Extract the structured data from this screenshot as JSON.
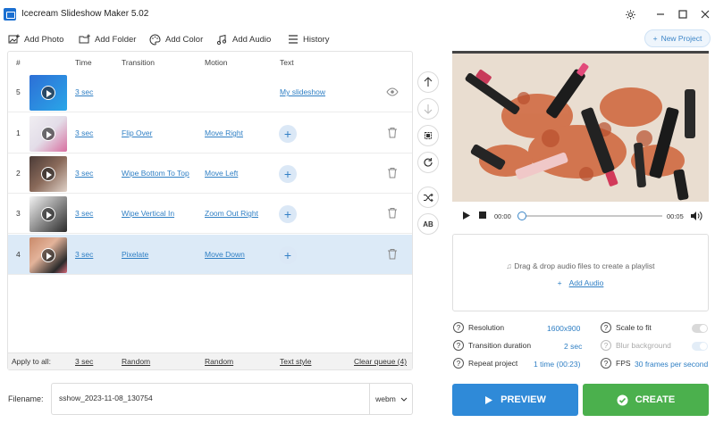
{
  "window": {
    "title": "Icecream Slideshow Maker 5.02"
  },
  "toolbar": {
    "add_photo": "Add Photo",
    "add_folder": "Add Folder",
    "add_color": "Add Color",
    "add_audio": "Add Audio",
    "history": "History",
    "new_project": "New Project"
  },
  "table": {
    "headers": {
      "num": "#",
      "time": "Time",
      "transition": "Transition",
      "motion": "Motion",
      "text": "Text"
    },
    "rows": [
      {
        "num": "5",
        "time": "3 sec",
        "transition": "",
        "motion": "",
        "text": "My slideshow",
        "thumb": "title-slide"
      },
      {
        "num": "1",
        "time": "3 sec",
        "transition": "Flip Over",
        "motion": "Move Right",
        "text": "",
        "thumb": "compact-pink"
      },
      {
        "num": "2",
        "time": "3 sec",
        "transition": "Wipe Bottom To Top",
        "motion": "Move Left",
        "text": "",
        "thumb": "brushes"
      },
      {
        "num": "3",
        "time": "3 sec",
        "transition": "Wipe Vertical In",
        "motion": "Zoom Out Right",
        "text": "",
        "thumb": "eyeshadow"
      },
      {
        "num": "4",
        "time": "3 sec",
        "transition": "Pixelate",
        "motion": "Move Down",
        "text": "",
        "thumb": "lipsticks"
      }
    ],
    "selected_row": 4
  },
  "apply_all": {
    "label": "Apply to all:",
    "time": "3 sec",
    "transition": "Random",
    "motion": "Random",
    "text": "Text style",
    "clear": "Clear queue (4)"
  },
  "filename": {
    "label": "Filename:",
    "value": "sshow_2023-11-08_130754",
    "format": "webm"
  },
  "player": {
    "current": "00:00",
    "end": "00:05",
    "progress": 0
  },
  "audio": {
    "hint": "Drag & drop audio files to create a playlist",
    "add_link": "Add Audio"
  },
  "settings": {
    "resolution_label": "Resolution",
    "resolution_value": "1600x900",
    "transition_label": "Transition duration",
    "transition_value": "2 sec",
    "repeat_label": "Repeat project",
    "repeat_value": "1 time (00:23)",
    "scale_label": "Scale to fit",
    "blur_label": "Blur background",
    "fps_label": "FPS",
    "fps_value": "30 frames per second"
  },
  "actions": {
    "preview": "PREVIEW",
    "create": "CREATE"
  },
  "colors": {
    "accent": "#2f8ad8",
    "create": "#4bb04d",
    "link": "#2f7fc4",
    "selected_row": "#dceaf7"
  }
}
